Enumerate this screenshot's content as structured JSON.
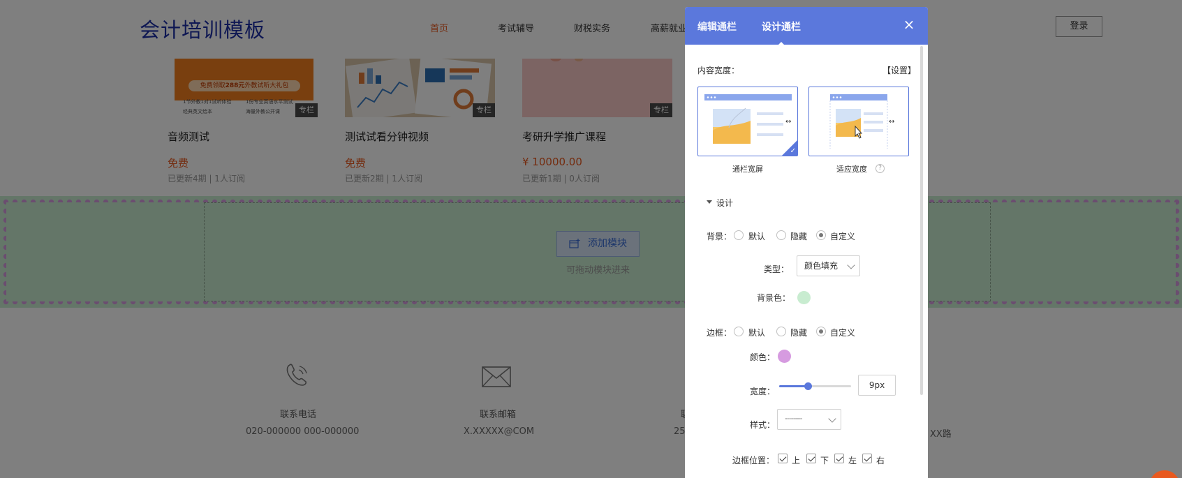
{
  "site": {
    "logo": "会计培训模板",
    "nav": [
      "首页",
      "考试辅导",
      "财税实务",
      "高薪就业"
    ],
    "login_label": "登录",
    "cards": [
      {
        "title": "音频测试",
        "price": "免费",
        "meta": "已更新4期 | 1人订阅",
        "tag": "专栏"
      },
      {
        "title": "测试试看分钟视频",
        "price": "免费",
        "meta": "已更新2期 | 1人订阅",
        "tag": "专栏"
      },
      {
        "title": "考研升学推广课程",
        "price": "¥ 10000.00",
        "meta": "已更新1期 | 0人订阅",
        "tag": "专栏"
      }
    ],
    "promo": {
      "line1_pre": "免费领取",
      "line1_hl": "288元",
      "line1_post": "外教试听大礼包",
      "items": [
        "1节外教1对1试听体验",
        "1份专业英语水平测试",
        "经典英文绘本",
        "海量外教公开课"
      ]
    },
    "add_module_label": "添加模块",
    "drag_hint": "可拖动模块进来",
    "footer": [
      {
        "label": "联系电话",
        "value": "020-000000 000-000000",
        "icon": "phone-icon"
      },
      {
        "label": "联系邮箱",
        "value": "X.XXXXX@COM",
        "icon": "mail-icon"
      },
      {
        "label": "联",
        "value": "25",
        "icon": "location-icon"
      },
      {
        "label": "",
        "value": "XX路",
        "icon": "wechat-icon"
      }
    ]
  },
  "panel": {
    "tabs": [
      "编辑通栏",
      "设计通栏"
    ],
    "content_width_label": "内容宽度：",
    "settings_link": "【设置】",
    "width_options": [
      "通栏宽屏",
      "适应宽度"
    ],
    "help_mark": "?",
    "design_section": "设计",
    "background": {
      "label": "背景：",
      "options": [
        "默认",
        "隐藏",
        "自定义"
      ],
      "selected": "自定义"
    },
    "type": {
      "label": "类型：",
      "value": "颜色填充"
    },
    "bg_color": {
      "label": "背景色：",
      "color": "#c8ecd0"
    },
    "border": {
      "label": "边框：",
      "options": [
        "默认",
        "隐藏",
        "自定义"
      ],
      "selected": "自定义"
    },
    "border_color": {
      "label": "颜色：",
      "color": "#d69be0"
    },
    "border_width": {
      "label": "宽度：",
      "value": "9px",
      "level": 0.4
    },
    "border_style": {
      "label": "样式：",
      "value": "················"
    },
    "border_position": {
      "label": "边框位置：",
      "options": [
        "上",
        "下",
        "左",
        "右"
      ]
    }
  },
  "colors": {
    "accent": "#5b78dc",
    "brand": "#1d2fa6",
    "price": "#e8591f"
  }
}
